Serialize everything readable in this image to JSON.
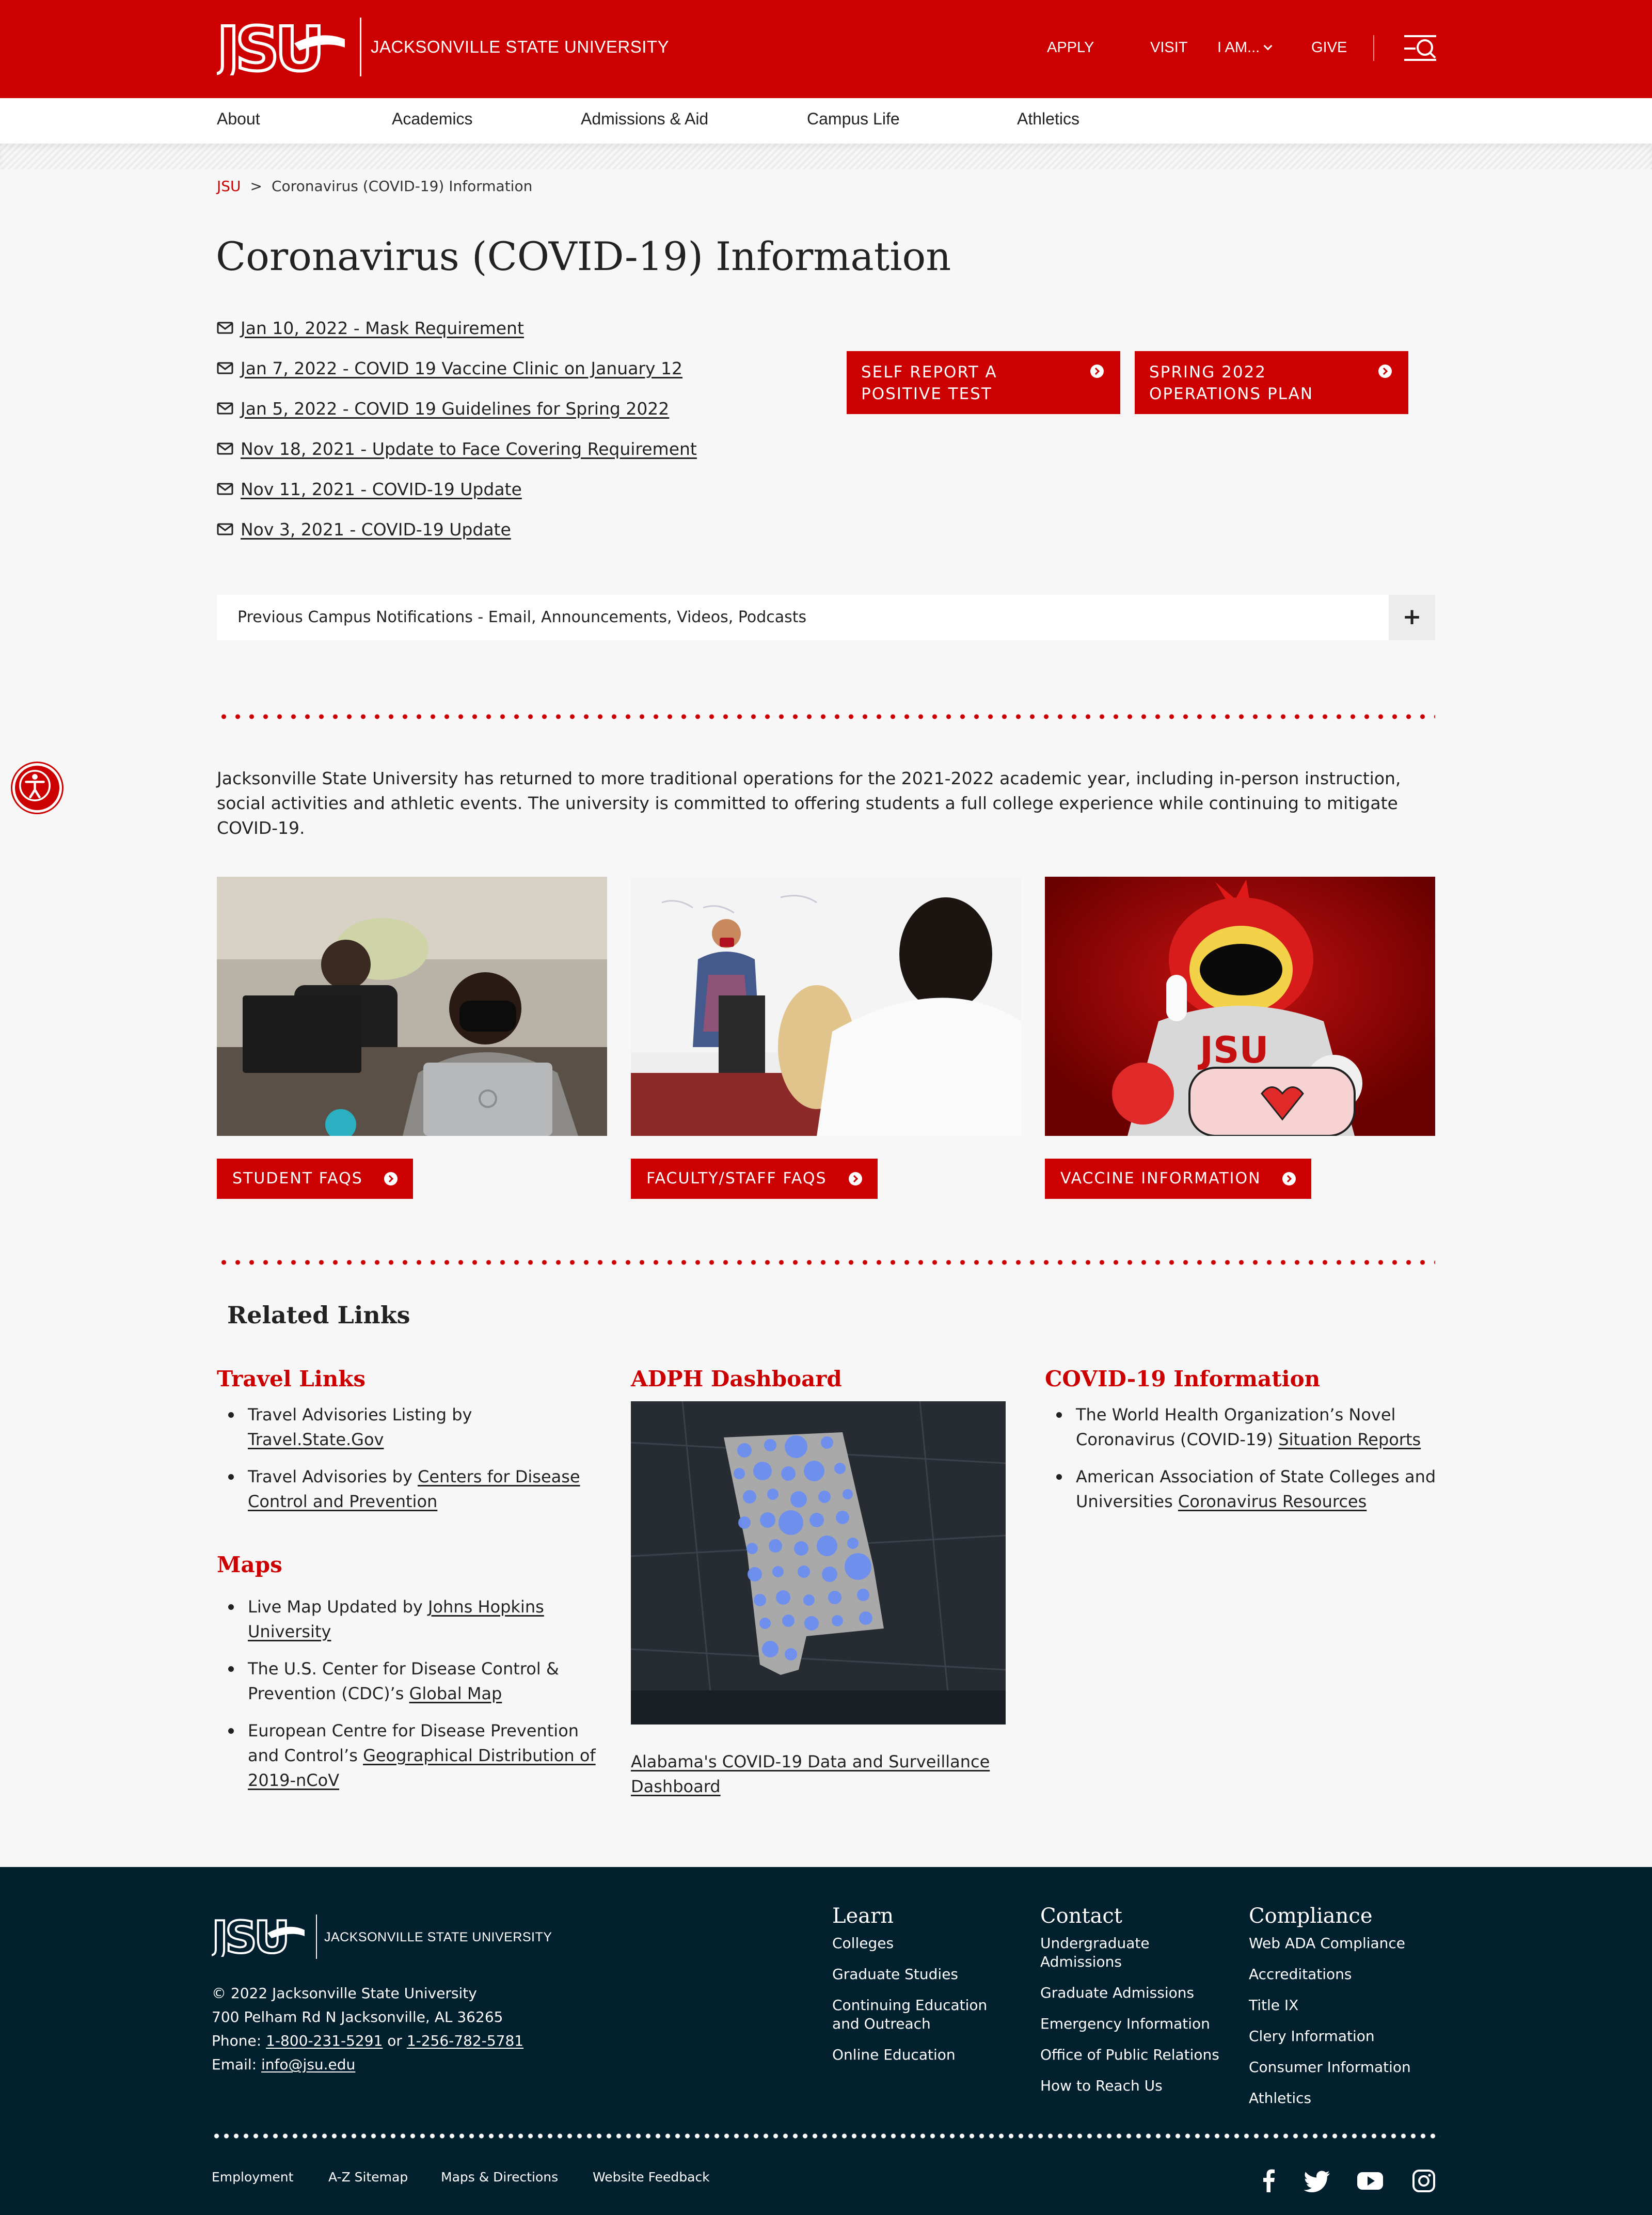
{
  "header": {
    "logo_text": "JACKSONVILLE STATE UNIVERSITY",
    "nav": [
      "APPLY",
      "VISIT",
      "I AM...",
      "GIVE"
    ],
    "menu_icon": "menu-search-icon"
  },
  "mainnav": [
    "About",
    "Academics",
    "Admissions & Aid",
    "Campus Life",
    "Athletics"
  ],
  "breadcrumb": {
    "home": "JSU",
    "separator": ">",
    "current": "Coronavirus (COVID-19) Information"
  },
  "page_title": "Coronavirus (COVID-19) Information",
  "notifications": [
    "Jan 10, 2022 - Mask Requirement",
    "Jan 7, 2022 - COVID 19 Vaccine Clinic on January 12",
    "Jan 5, 2022 - COVID 19 Guidelines for Spring 2022",
    "Nov 18, 2021 - Update to Face Covering Requirement",
    "Nov 11, 2021 - COVID-19 Update",
    "Nov 3, 2021 - COVID-19 Update"
  ],
  "cta": [
    "SELF REPORT A POSITIVE TEST",
    "SPRING 2022 OPERATIONS PLAN"
  ],
  "accordion": {
    "label": "Previous Campus Notifications - Email, Announcements, Videos, Podcasts",
    "toggle": "+"
  },
  "intro": "Jacksonville State University has returned to more traditional operations for the 2021-2022 academic year, including in-person instruction, social activities and athletic events. The university is committed to offering students a full college experience while continuing to mitigate COVID-19.",
  "buttons": [
    "STUDENT FAQS",
    "FACULTY/STAFF FAQS",
    "VACCINE INFORMATION"
  ],
  "related": {
    "title": "Related Links",
    "travel": {
      "heading": "Travel Links",
      "items": [
        {
          "pre": "Travel Advisories Listing by ",
          "link": "Travel.State.Gov"
        },
        {
          "pre": "Travel Advisories by ",
          "link": "Centers for Disease Control and Prevention"
        }
      ]
    },
    "maps": {
      "heading": "Maps",
      "items": [
        {
          "pre": "Live Map Updated by ",
          "link": "Johns Hopkins University"
        },
        {
          "pre": "The U.S. Center for Disease Control & Prevention (CDC)’s ",
          "link": "Global Map "
        },
        {
          "pre": "European Centre for Disease Prevention and Control’s ",
          "link": "Geographical Distribution of 2019-nCoV"
        }
      ]
    },
    "adph": {
      "heading": "ADPH Dashboard",
      "caption": "Alabama's COVID-19 Data and Surveillance Dashboard"
    },
    "covid": {
      "heading": "COVID-19 Information",
      "items": [
        {
          "pre": "The World Health Organization’s Novel Coronavirus (COVID-19) ",
          "link": "Situation Reports"
        },
        {
          "pre": "American Association of State Colleges and Universities ",
          "link": "Coronavirus Resources"
        }
      ]
    }
  },
  "footer": {
    "logo_text": "JACKSONVILLE STATE UNIVERSITY",
    "copyright": "© 2022 Jacksonville State University",
    "address": "700 Pelham Rd N Jacksonville, AL 36265",
    "phone_label": "Phone: ",
    "phone1": "1-800-231-5291",
    "phone_or": " or ",
    "phone2": "1-256-782-5781",
    "email_label": "Email: ",
    "email": "info@jsu.edu",
    "learn": {
      "heading": "Learn",
      "items": [
        "Colleges",
        "Graduate Studies",
        "Continuing Education and Outreach",
        "Online Education"
      ]
    },
    "contact": {
      "heading": "Contact",
      "items": [
        "Undergraduate Admissions",
        "Graduate Admissions",
        "Emergency Information",
        "Office of Public Relations",
        "How to Reach Us"
      ]
    },
    "compliance": {
      "heading": "Compliance",
      "items": [
        "Web ADA Compliance",
        "Accreditations",
        "Title IX",
        "Clery Information",
        "Consumer Information",
        "Athletics"
      ]
    },
    "bottom_links": [
      "Employment",
      "A-Z Sitemap",
      "Maps & Directions",
      "Website Feedback"
    ],
    "social": [
      "facebook-icon",
      "twitter-icon",
      "youtube-icon",
      "instagram-icon"
    ]
  },
  "colors": {
    "brand_red": "#cc0000",
    "footer_navy": "#03202f",
    "page_bg": "#f7f7f7"
  }
}
